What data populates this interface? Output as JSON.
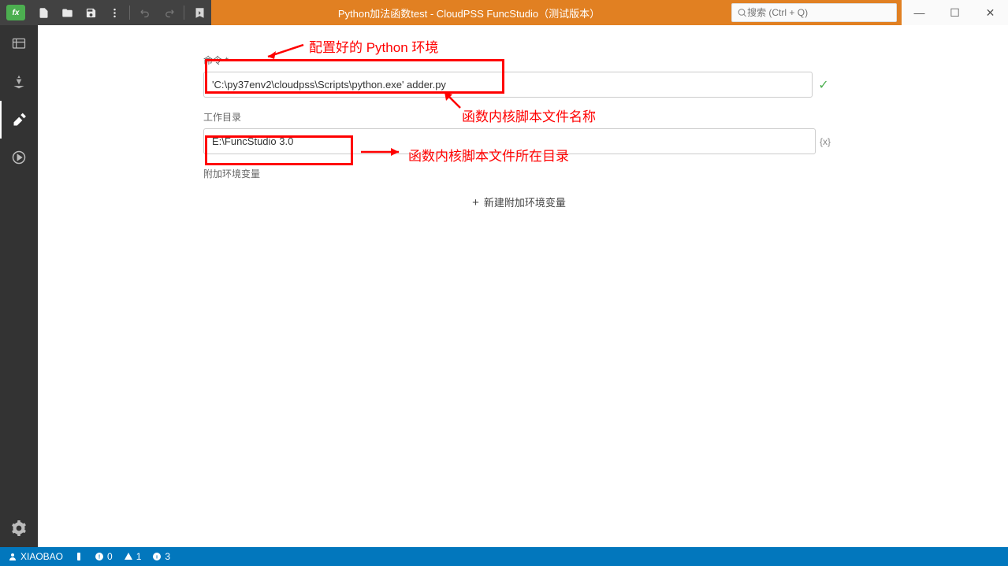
{
  "titlebar": {
    "logo_text": "fx",
    "title": "Python加法函数test - CloudPSS FuncStudio（测试版本）",
    "search_placeholder": "搜索 (Ctrl + Q)"
  },
  "form": {
    "command_label": "命令 *",
    "command_value": "'C:\\py37env2\\cloudpss\\Scripts\\python.exe' adder.py",
    "workdir_label": "工作目录",
    "workdir_value": "E:\\FuncStudio 3.0",
    "workdir_suffix": "{x}",
    "env_label": "附加环境变量",
    "add_env": "新建附加环境变量"
  },
  "annotations": {
    "a1": "配置好的 Python 环境",
    "a2": "函数内核脚本文件名称",
    "a3": "函数内核脚本文件所在目录"
  },
  "status": {
    "user": "XIAOBAO",
    "errors": "0",
    "warnings": "1",
    "info": "3"
  }
}
